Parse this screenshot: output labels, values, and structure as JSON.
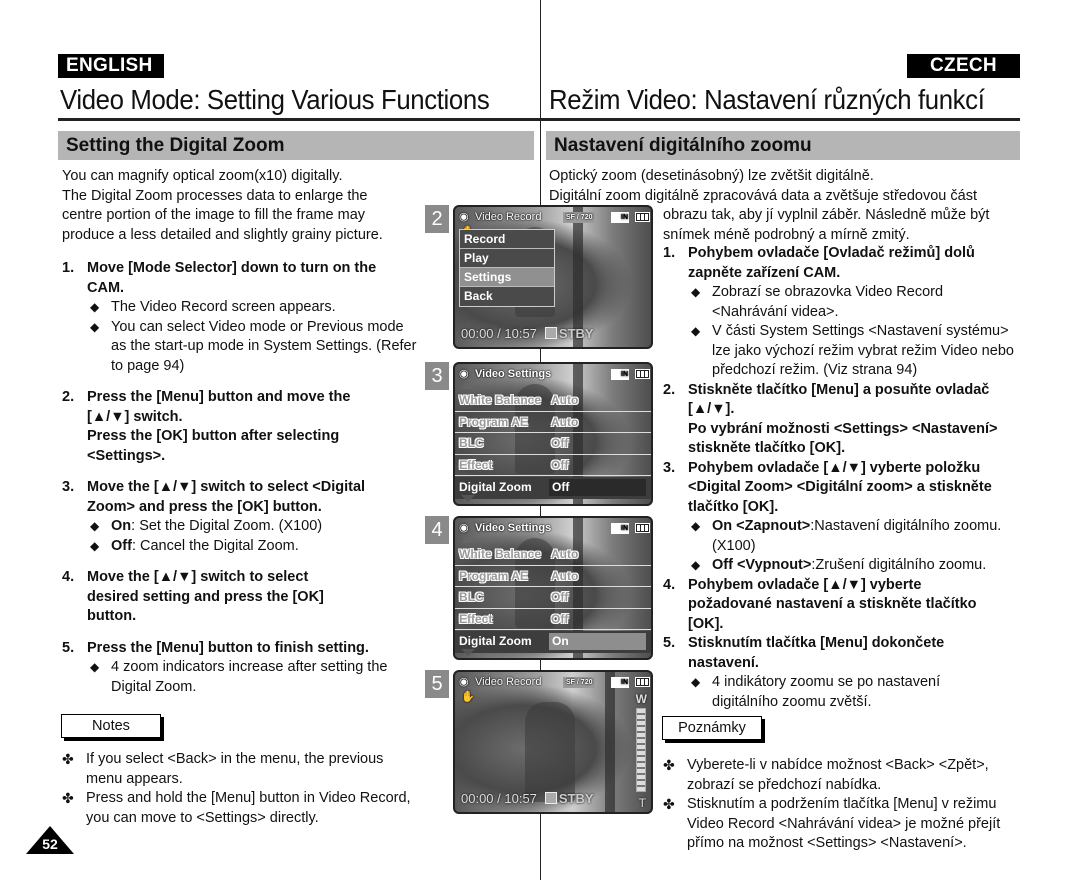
{
  "english": {
    "language_badge": "ENGLISH",
    "page_title": "Video Mode: Setting Various Functions",
    "section_title": "Setting the Digital Zoom",
    "intro": [
      "You can magnify optical zoom(x10) digitally.",
      "The Digital Zoom processes data to enlarge the",
      "centre portion of the image to fill the frame may",
      "produce a less detailed and slightly grainy picture."
    ],
    "steps": [
      {
        "number": "1.",
        "text": "Move [Mode Selector] down to turn on the CAM.",
        "bullets": [
          {
            "bold": "",
            "text": "The Video Record screen appears."
          },
          {
            "bold": "",
            "text": "You can select Video mode or Previous mode as the start-up mode in System Settings. (Refer to page 94)"
          }
        ]
      },
      {
        "number": "2.",
        "text": "Press the [Menu] button and move the [▲/▼] switch.",
        "text2": "Press the [OK] button after selecting <Settings>.",
        "bullets": []
      },
      {
        "number": "3.",
        "text": "Move the [▲/▼] switch to select <Digital Zoom> and press the [OK] button.",
        "bullets": [
          {
            "bold": "On",
            "text": ": Set the Digital Zoom. (X100)"
          },
          {
            "bold": "Off",
            "text": ": Cancel the Digital Zoom."
          }
        ]
      },
      {
        "number": "4.",
        "text": "Move the [▲/▼] switch to select desired setting and press the [OK] button.",
        "bullets": []
      },
      {
        "number": "5.",
        "text": "Press the [Menu] button to finish setting.",
        "bullets": [
          {
            "bold": "",
            "text": "4 zoom indicators increase after setting the Digital Zoom."
          }
        ]
      }
    ],
    "notes_label": "Notes",
    "notes": [
      "If you select <Back> in the menu, the previous menu appears.",
      "Press and hold the [Menu] button in Video Record, you can move to <Settings> directly."
    ]
  },
  "czech": {
    "language_badge": "CZECH",
    "page_title": "Režim Video: Nastavení různých funkcí",
    "section_title": "Nastavení digitálního zoomu",
    "intro_full": [
      "Optický zoom (desetinásobný) lze zvětšit digitálně.",
      "Digitální zoom digitálně zpracovává data a zvětšuje středovou část"
    ],
    "intro_wrapped": [
      "obrazu tak, aby jí vyplnil záběr. Následně může být",
      "snímek méně podrobný a mírně zmitý."
    ],
    "steps": [
      {
        "number": "1.",
        "text": "Pohybem ovladače [Ovladač režimů] dolů zapněte zařízení CAM.",
        "bullets": [
          {
            "bold": "",
            "text": "Zobrazí se obrazovka Video Record <Nahrávání videa>."
          },
          {
            "bold": "",
            "text": "V části System Settings <Nastavení systému> lze jako výchozí režim vybrat režim Video nebo předchozí režim. (Viz strana 94)"
          }
        ]
      },
      {
        "number": "2.",
        "text": "Stiskněte tlačítko [Menu] a posuňte ovladač [▲/▼].",
        "text2": "Po vybrání možnosti <Settings> <Nastavení> stiskněte tlačítko [OK].",
        "bullets": []
      },
      {
        "number": "3.",
        "text": "Pohybem ovladače [▲/▼] vyberte položku <Digital Zoom> <Digitální zoom> a stiskněte tlačítko [OK].",
        "bullets": [
          {
            "bold": "On <Zapnout>",
            "text": ":Nastavení digitálního zoomu. (X100)"
          },
          {
            "bold": "Off <Vypnout>",
            "text": ":Zrušení digitálního zoomu."
          }
        ]
      },
      {
        "number": "4.",
        "text": "Pohybem ovladače [▲/▼] vyberte požadované nastavení a stiskněte tlačítko [OK].",
        "bullets": []
      },
      {
        "number": "5.",
        "text": "Stisknutím tlačítka [Menu] dokončete nastavení.",
        "bullets": [
          {
            "bold": "",
            "text": "4 indikátory zoomu se po nastavení digitálního zoomu zvětší."
          }
        ]
      }
    ],
    "notes_label": "Poznámky",
    "notes": [
      "Vyberete-li v nabídce možnost <Back> <Zpět>, zobrazí se předchozí nabídka.",
      "Stisknutím a podržením tlačítka [Menu] v režimu Video Record <Nahrávání videa> je možné přejít přímo na možnost <Settings> <Nastavení>."
    ]
  },
  "screens": [
    {
      "number": "2",
      "title": "Video Record",
      "quality": "SF",
      "resolution": "720",
      "memory": "IN",
      "menu": [
        "Record",
        "Play",
        "Settings",
        "Back"
      ],
      "selected_menu": "Settings",
      "counter": "00:00 / 10:57",
      "status": "STBY"
    },
    {
      "number": "3",
      "title": "Video Settings",
      "memory": "IN",
      "rows": [
        {
          "label": "White Balance",
          "value": "Auto"
        },
        {
          "label": "Program AE",
          "value": "Auto"
        },
        {
          "label": "BLC",
          "value": "Off"
        },
        {
          "label": "Effect",
          "value": "Off"
        },
        {
          "label": "Digital Zoom",
          "value": "Off"
        }
      ]
    },
    {
      "number": "4",
      "title": "Video Settings",
      "memory": "IN",
      "rows": [
        {
          "label": "White Balance",
          "value": "Auto"
        },
        {
          "label": "Program AE",
          "value": "Auto"
        },
        {
          "label": "BLC",
          "value": "Off"
        },
        {
          "label": "Effect",
          "value": "Off"
        },
        {
          "label": "Digital Zoom",
          "value": "On"
        }
      ]
    },
    {
      "number": "5",
      "title": "Video Record",
      "quality": "SF",
      "resolution": "720",
      "memory": "IN",
      "zoom_wide": "W",
      "zoom_tele": "T",
      "counter": "00:00 / 10:57",
      "status": "STBY"
    }
  ],
  "page_number": "52",
  "icons": {
    "bullet": "◆",
    "note": "✤",
    "camcorder": "camcorder-icon",
    "stabilizer": "hand-shake-icon",
    "battery": "battery-icon"
  }
}
